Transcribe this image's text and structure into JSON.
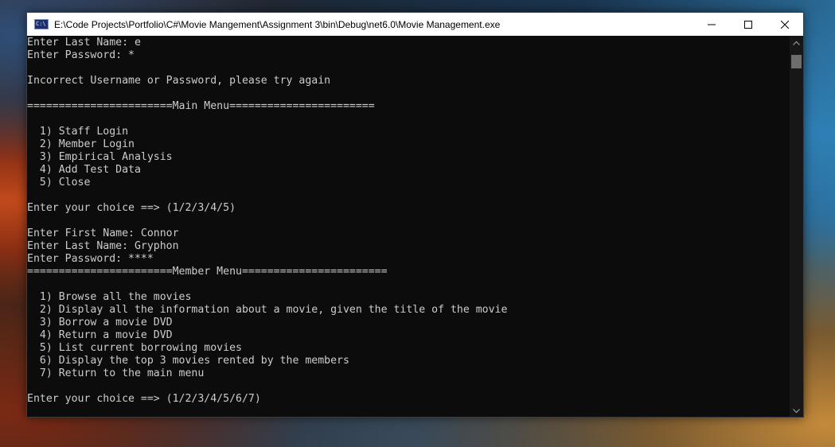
{
  "window": {
    "title": "E:\\Code Projects\\Portfolio\\C#\\Movie Mangement\\Assignment 3\\bin\\Debug\\net6.0\\Movie Management.exe",
    "icon": "console-app-icon",
    "icon_text": "C:\\",
    "controls": [
      "minimize-icon",
      "maximize-icon",
      "close-icon"
    ]
  },
  "console": {
    "lines": [
      "Enter Last Name: e",
      "Enter Password: *",
      "",
      "Incorrect Username or Password, please try again",
      "",
      "=======================Main Menu=======================",
      "",
      "  1) Staff Login",
      "  2) Member Login",
      "  3) Empirical Analysis",
      "  4) Add Test Data",
      "  5) Close",
      "",
      "Enter your choice ==> (1/2/3/4/5)",
      "",
      "Enter First Name: Connor",
      "Enter Last Name: Gryphon",
      "Enter Password: ****",
      "=======================Member Menu=======================",
      "",
      "  1) Browse all the movies",
      "  2) Display all the information about a movie, given the title of the movie",
      "  3) Borrow a movie DVD",
      "  4) Return a movie DVD",
      "  5) List current borrowing movies",
      "  6) Display the top 3 movies rented by the members",
      "  7) Return to the main menu",
      "",
      "Enter your choice ==> (1/2/3/4/5/6/7)"
    ]
  },
  "colors": {
    "console_bg": "#0c0c0c",
    "console_text": "#cccccc",
    "titlebar_bg": "#ffffff"
  }
}
